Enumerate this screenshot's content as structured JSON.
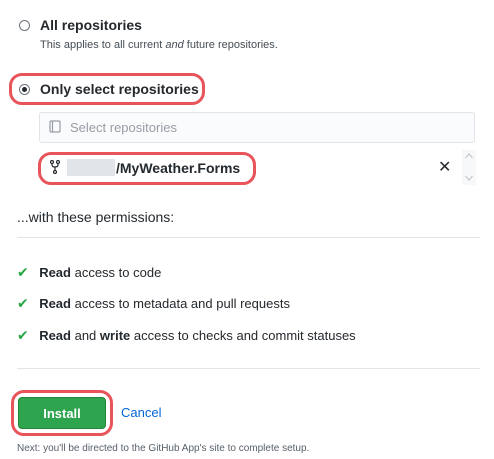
{
  "options": {
    "all": {
      "label": "All repositories",
      "desc_prefix": "This applies to all current ",
      "desc_em": "and",
      "desc_suffix": " future repositories."
    },
    "select": {
      "label": "Only select repositories"
    }
  },
  "repo_picker": {
    "placeholder": "Select repositories",
    "selected_repo": "/MyWeather.Forms",
    "remove_symbol": "✕"
  },
  "permissions": {
    "heading": "...with these permissions:",
    "items": [
      {
        "parts": [
          {
            "t": "Read",
            "b": true
          },
          {
            "t": " access to code",
            "b": false
          }
        ]
      },
      {
        "parts": [
          {
            "t": "Read",
            "b": true
          },
          {
            "t": " access to metadata and pull requests",
            "b": false
          }
        ]
      },
      {
        "parts": [
          {
            "t": "Read",
            "b": true
          },
          {
            "t": " and ",
            "b": false
          },
          {
            "t": "write",
            "b": true
          },
          {
            "t": " access to checks and commit statuses",
            "b": false
          }
        ]
      }
    ]
  },
  "actions": {
    "install": "Install",
    "cancel": "Cancel",
    "note": "Next: you'll be directed to the GitHub App's site to complete setup."
  },
  "colors": {
    "accent_highlight": "#e8545a",
    "install_green": "#2ea44f",
    "link_blue": "#0366d6",
    "check_green": "#28a745"
  }
}
